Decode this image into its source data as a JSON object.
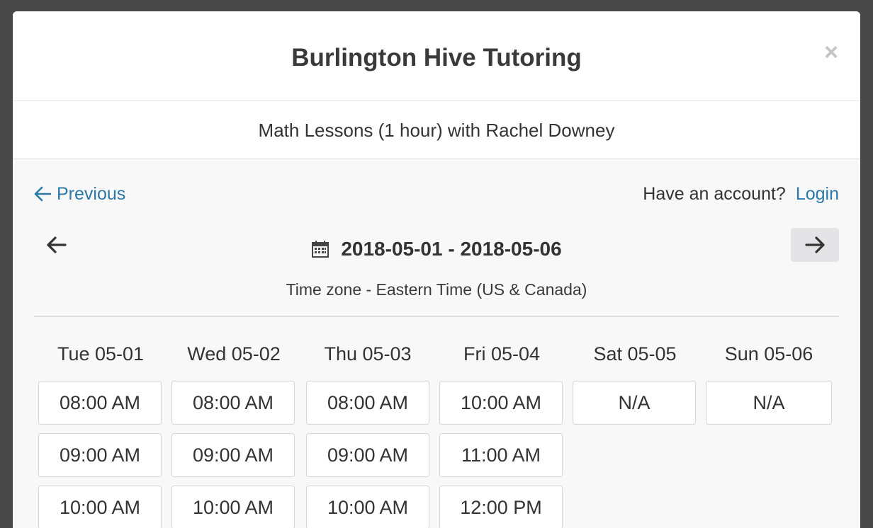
{
  "modal": {
    "title": "Burlington Hive Tutoring",
    "close_label": "×",
    "subtitle": "Math Lessons (1 hour) with Rachel Downey"
  },
  "nav": {
    "previous_label": "Previous",
    "account_prompt": "Have an account?",
    "login_label": "Login"
  },
  "calendar": {
    "date_range": "2018-05-01 - 2018-05-06",
    "timezone": "Time zone - Eastern Time (US & Canada)",
    "days": [
      {
        "label": "Tue 05-01",
        "slots": [
          "08:00 AM",
          "09:00 AM",
          "10:00 AM"
        ]
      },
      {
        "label": "Wed 05-02",
        "slots": [
          "08:00 AM",
          "09:00 AM",
          "10:00 AM"
        ]
      },
      {
        "label": "Thu 05-03",
        "slots": [
          "08:00 AM",
          "09:00 AM",
          "10:00 AM"
        ]
      },
      {
        "label": "Fri 05-04",
        "slots": [
          "10:00 AM",
          "11:00 AM",
          "12:00 PM"
        ]
      },
      {
        "label": "Sat 05-05",
        "slots": [
          "N/A"
        ]
      },
      {
        "label": "Sun 05-06",
        "slots": [
          "N/A"
        ]
      }
    ]
  },
  "colors": {
    "link": "#2a79a8",
    "backdrop": "#474747",
    "nav_button_bg": "#e4e4e6"
  },
  "icons": {
    "previous": "arrow-left-icon",
    "prev_week": "arrow-left-icon",
    "next_week": "arrow-right-icon",
    "calendar": "calendar-icon",
    "close": "close-icon"
  }
}
